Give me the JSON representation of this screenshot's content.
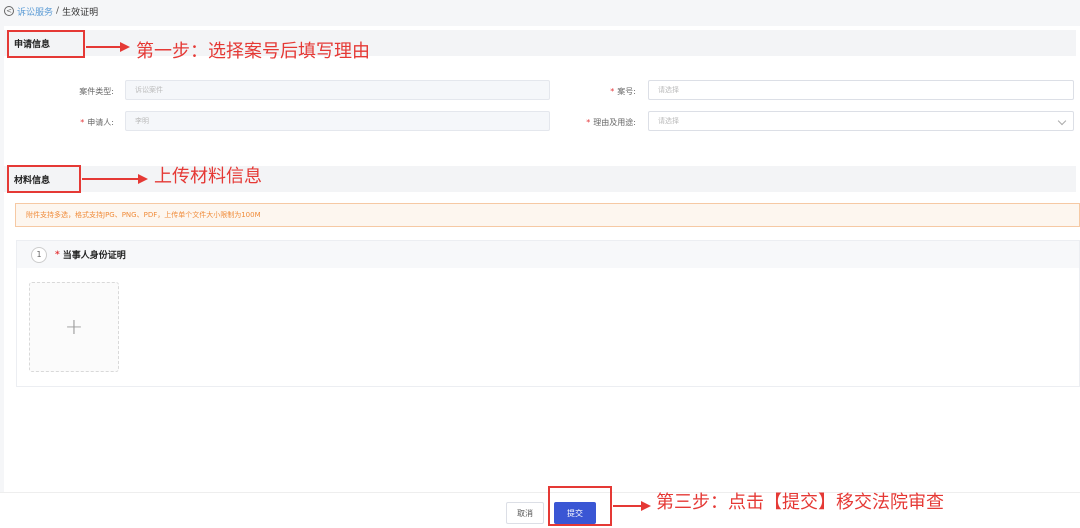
{
  "breadcrumb": {
    "parent": "诉讼服务",
    "separator": "/",
    "current": "生效证明"
  },
  "sections": {
    "apply_info": "申请信息",
    "material_info": "材料信息"
  },
  "form": {
    "case_type": {
      "label": "案件类型:",
      "value": "诉讼案件"
    },
    "case_no": {
      "required": "*",
      "label": "案号:",
      "placeholder": "请选择"
    },
    "applicant": {
      "required": "*",
      "label": "申请人:",
      "value": "李明"
    },
    "reason": {
      "required": "*",
      "label": "理由及用途:",
      "placeholder": "请选择"
    }
  },
  "notice": "附件支持多选，格式支持JPG、PNG、PDF，上传单个文件大小限制为100M",
  "materials": [
    {
      "index": "1",
      "required": "*",
      "title": "当事人身份证明"
    }
  ],
  "upload_plus": "+",
  "buttons": {
    "cancel": "取消",
    "submit": "提交"
  },
  "annotations": {
    "step1": "第一步：选择案号后填写理由",
    "step2": "上传材料信息",
    "step3": "第三步：点击【提交】移交法院审查"
  },
  "colors": {
    "annotation": "#e53935",
    "primary": "#3a56d4",
    "notice": "#f08c3b",
    "link": "#5b9bd5"
  }
}
